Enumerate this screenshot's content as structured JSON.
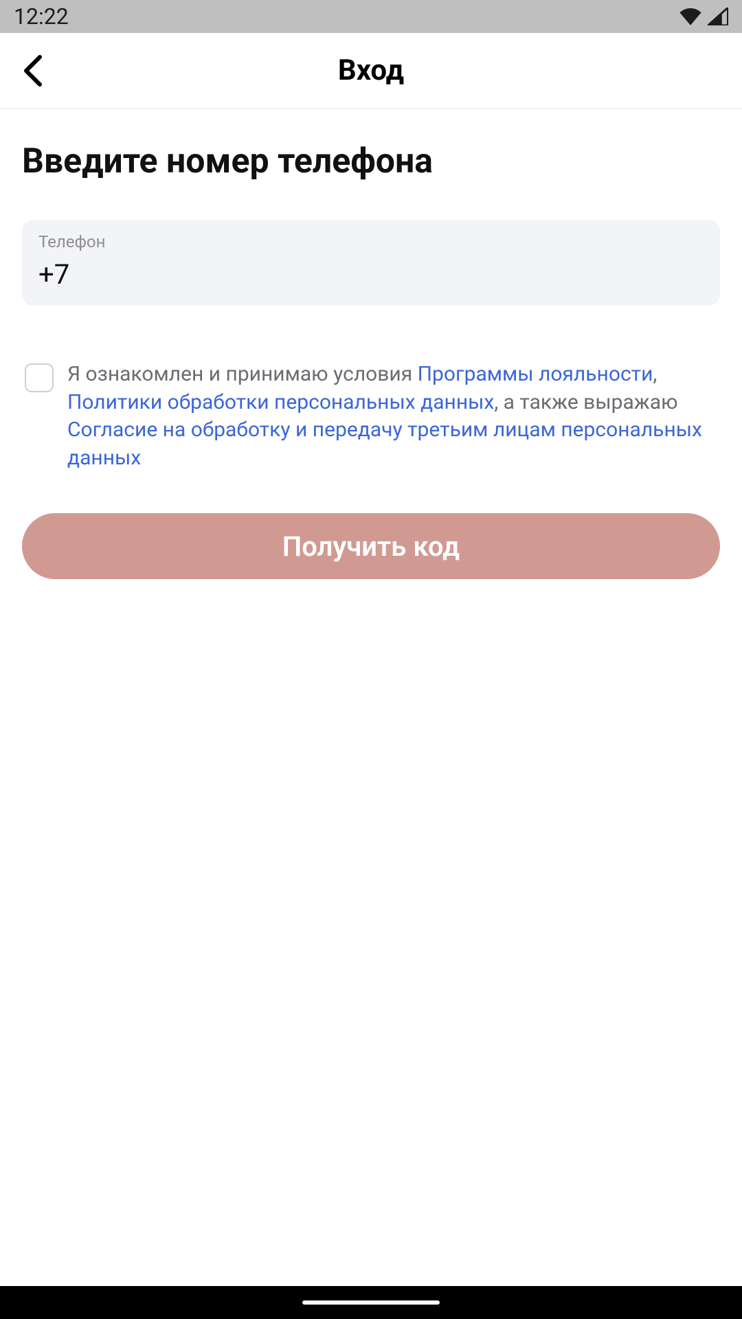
{
  "statusBar": {
    "time": "12:22"
  },
  "nav": {
    "title": "Вход"
  },
  "main": {
    "heading": "Введите номер телефона",
    "phone": {
      "label": "Телефон",
      "value": "+7"
    },
    "consent": {
      "part1": "Я ознакомлен и принимаю условия ",
      "link1": "Программы лояльности",
      "sep1": ", ",
      "link2": "Политики обработки персональных данных",
      "part2": ", а также выражаю ",
      "link3": "Согласие на обработку и передачу третьим лицам персональных данных"
    },
    "submitLabel": "Получить код"
  }
}
